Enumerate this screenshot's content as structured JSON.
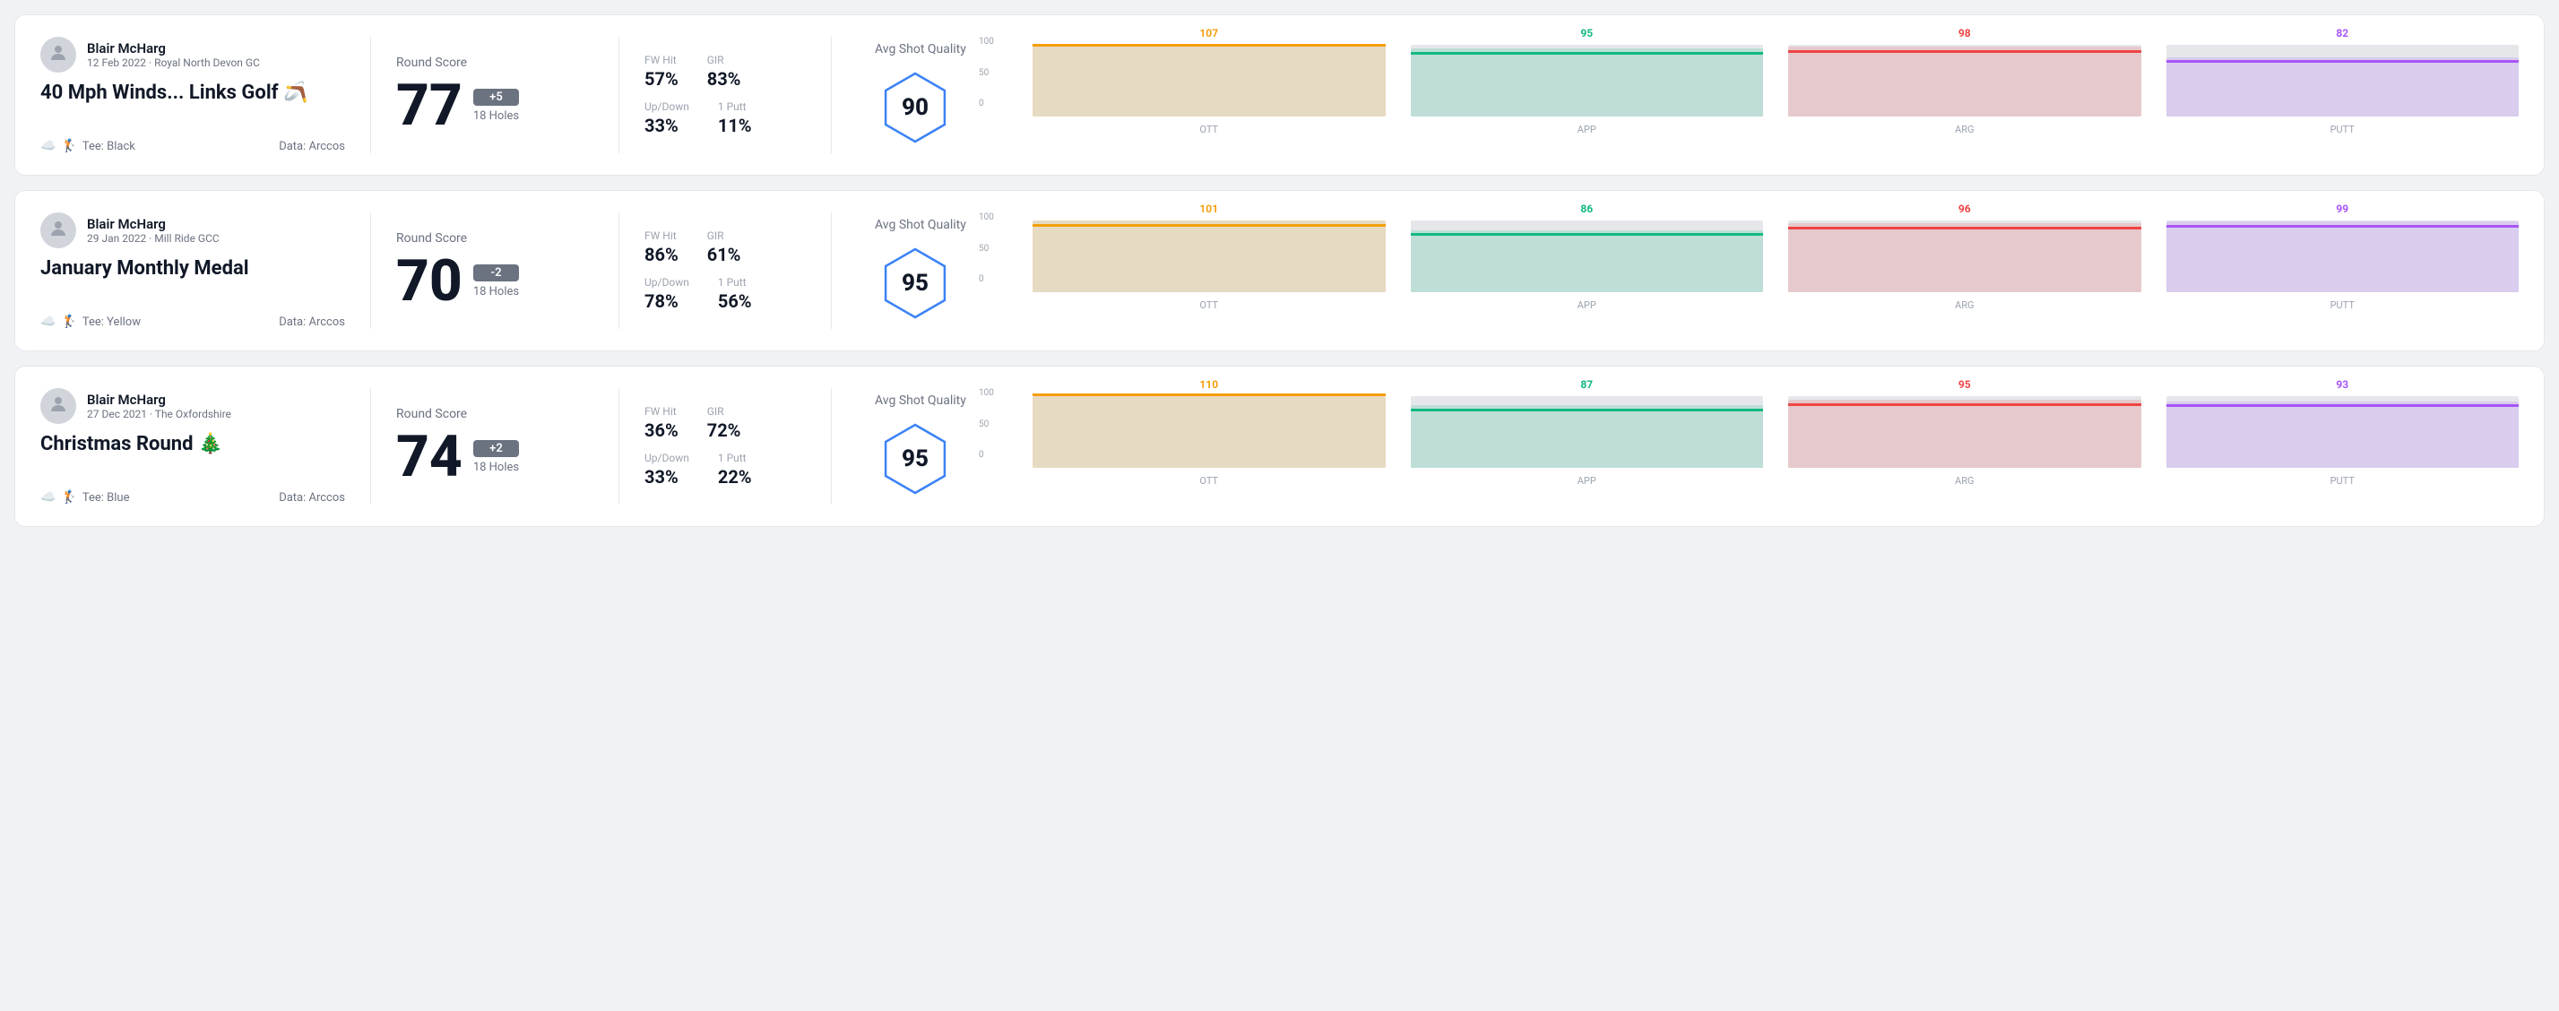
{
  "rounds": [
    {
      "id": "round-1",
      "user": {
        "name": "Blair McHarg",
        "date": "12 Feb 2022 · Royal North Devon GC"
      },
      "title": "40 Mph Winds... Links Golf 🪃",
      "tee": "Black",
      "data_source": "Data: Arccos",
      "score": {
        "value": "77",
        "badge": "+5",
        "badge_type": "over",
        "holes": "18 Holes"
      },
      "stats": {
        "fw_hit_label": "FW Hit",
        "fw_hit_value": "57%",
        "gir_label": "GIR",
        "gir_value": "83%",
        "updown_label": "Up/Down",
        "updown_value": "33%",
        "putt_label": "1 Putt",
        "putt_value": "11%"
      },
      "quality": {
        "label": "Avg Shot Quality",
        "score": "90"
      },
      "chart": {
        "bars": [
          {
            "label": "OTT",
            "value": 107,
            "color": "#f59e0b"
          },
          {
            "label": "APP",
            "value": 95,
            "color": "#10b981"
          },
          {
            "label": "ARG",
            "value": 98,
            "color": "#ef4444"
          },
          {
            "label": "PUTT",
            "value": 82,
            "color": "#a855f7"
          }
        ],
        "y_max": 100,
        "y_labels": [
          "100",
          "50",
          "0"
        ]
      }
    },
    {
      "id": "round-2",
      "user": {
        "name": "Blair McHarg",
        "date": "29 Jan 2022 · Mill Ride GCC"
      },
      "title": "January Monthly Medal",
      "tee": "Yellow",
      "data_source": "Data: Arccos",
      "score": {
        "value": "70",
        "badge": "-2",
        "badge_type": "under",
        "holes": "18 Holes"
      },
      "stats": {
        "fw_hit_label": "FW Hit",
        "fw_hit_value": "86%",
        "gir_label": "GIR",
        "gir_value": "61%",
        "updown_label": "Up/Down",
        "updown_value": "78%",
        "putt_label": "1 Putt",
        "putt_value": "56%"
      },
      "quality": {
        "label": "Avg Shot Quality",
        "score": "95"
      },
      "chart": {
        "bars": [
          {
            "label": "OTT",
            "value": 101,
            "color": "#f59e0b"
          },
          {
            "label": "APP",
            "value": 86,
            "color": "#10b981"
          },
          {
            "label": "ARG",
            "value": 96,
            "color": "#ef4444"
          },
          {
            "label": "PUTT",
            "value": 99,
            "color": "#a855f7"
          }
        ],
        "y_max": 100,
        "y_labels": [
          "100",
          "50",
          "0"
        ]
      }
    },
    {
      "id": "round-3",
      "user": {
        "name": "Blair McHarg",
        "date": "27 Dec 2021 · The Oxfordshire"
      },
      "title": "Christmas Round 🎄",
      "tee": "Blue",
      "data_source": "Data: Arccos",
      "score": {
        "value": "74",
        "badge": "+2",
        "badge_type": "over",
        "holes": "18 Holes"
      },
      "stats": {
        "fw_hit_label": "FW Hit",
        "fw_hit_value": "36%",
        "gir_label": "GIR",
        "gir_value": "72%",
        "updown_label": "Up/Down",
        "updown_value": "33%",
        "putt_label": "1 Putt",
        "putt_value": "22%"
      },
      "quality": {
        "label": "Avg Shot Quality",
        "score": "95"
      },
      "chart": {
        "bars": [
          {
            "label": "OTT",
            "value": 110,
            "color": "#f59e0b"
          },
          {
            "label": "APP",
            "value": 87,
            "color": "#10b981"
          },
          {
            "label": "ARG",
            "value": 95,
            "color": "#ef4444"
          },
          {
            "label": "PUTT",
            "value": 93,
            "color": "#a855f7"
          }
        ],
        "y_max": 100,
        "y_labels": [
          "100",
          "50",
          "0"
        ]
      }
    }
  ]
}
